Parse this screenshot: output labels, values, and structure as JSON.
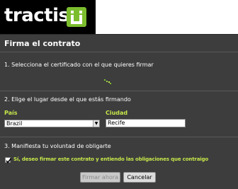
{
  "brand": {
    "name": "tractis",
    "logo_icon": "tractis-logo-icon",
    "accent": "#7cbd2e"
  },
  "dialog": {
    "title": "Firma el contrato",
    "step1": "1. Selecciona el certificado con el que quieres firmar",
    "loading_icon": "loading-spinner-icon",
    "step2": "2. Elige el lugar desde el que estás firmando",
    "country_label": "País",
    "country_value": "Brazil",
    "city_label": "Ciudad",
    "city_value": "Recife",
    "step3": "3. Manifiesta tu voluntad de obligarte",
    "consent_checked": true,
    "consent_label": "Sí, deseo firmar este contrato y entiendo las obligaciones que contraigo",
    "sign_button": "Firmar ahora",
    "cancel_button": "Cancelar",
    "label_color": "#c6e84a",
    "panel_color": "#3d3d3d"
  }
}
